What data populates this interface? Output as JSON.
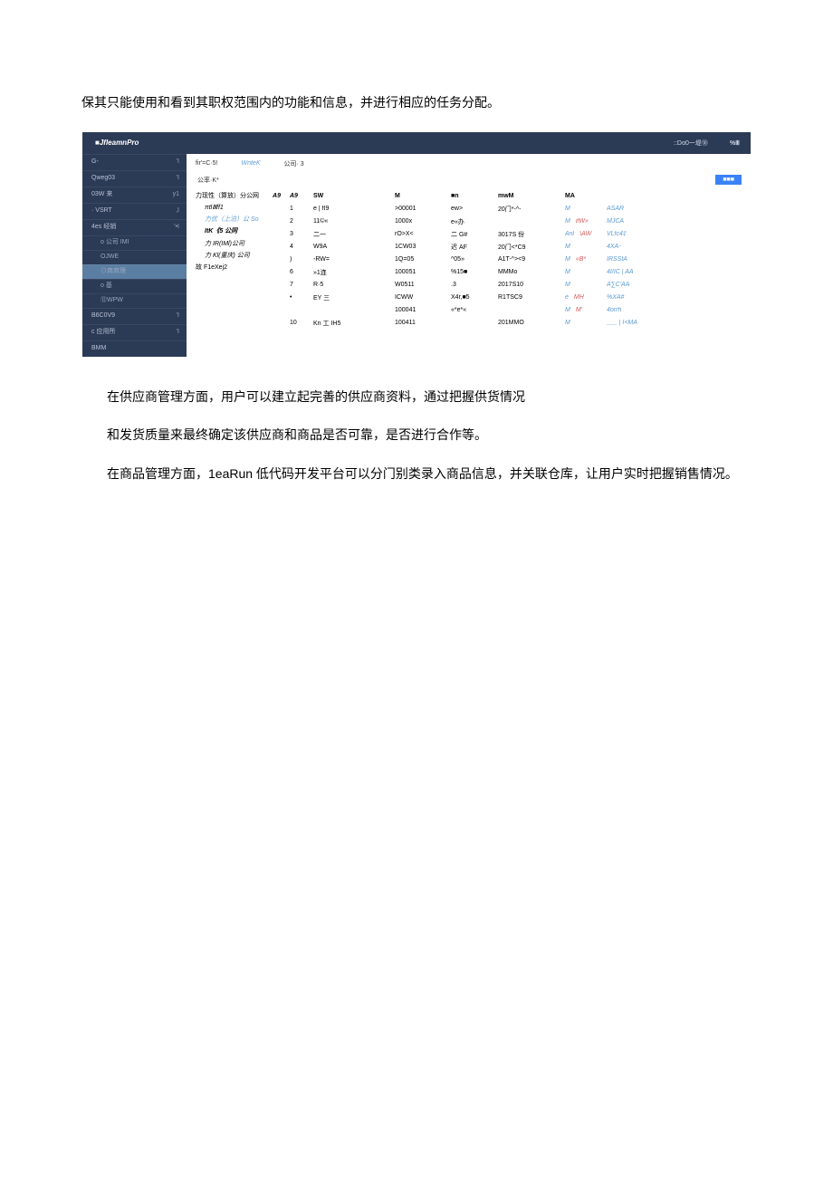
{
  "paragraphs": {
    "p1": "保其只能使用和看到其职权范围内的功能和信息，并进行相应的任务分配。",
    "p2": "在供应商管理方面，用户可以建立起完善的供应商资料，通过把握供货情况",
    "p3": "和发货质量来最终确定该供应商和商品是否可靠，是否进行合作等。",
    "p4": "在商品管理方面，1eaRun 低代码开发平台可以分门别类录入商品信息，并关联仓库，让用户实时把握销售情况。"
  },
  "app": {
    "brand": "■JfleamnPro",
    "header": {
      "r1": "::Dα0一堤⑩",
      "r2": "%Ⅲ"
    },
    "sidebar": [
      {
        "label": "G-",
        "arrow": "'I",
        "sub": false
      },
      {
        "label": "Qweg03",
        "arrow": "'I",
        "sub": false
      },
      {
        "label": "03W 来",
        "arrow": "y1",
        "sub": false
      },
      {
        "label": "· VSRT",
        "arrow": "‚I",
        "sub": false
      },
      {
        "label": "4es 经销",
        "arrow": "'•I",
        "sub": false
      },
      {
        "label": "o 公司 IMI",
        "arrow": "",
        "sub": true
      },
      {
        "label": "OJWE",
        "arrow": "",
        "sub": true
      },
      {
        "label": "⊙商商理",
        "arrow": "",
        "sub": true,
        "active": true
      },
      {
        "label": "o 基",
        "arrow": "",
        "sub": true
      },
      {
        "label": "⑫WPW",
        "arrow": "",
        "sub": true
      },
      {
        "label": "B6C0V9",
        "arrow": "'I",
        "sub": false
      },
      {
        "label": "c 应用所",
        "arrow": "'I",
        "sub": false
      },
      {
        "label": "BMM",
        "arrow": "",
        "sub": false
      }
    ],
    "tabs": {
      "t1": "fir'=C·5!",
      "t2": "WnteK",
      "t3": "公司· 3"
    },
    "subtabs": {
      "s1": "公率·K*",
      "btn": "■■■"
    },
    "tree": {
      "row0": {
        "a": "力现性（算放）分公网",
        "b": "A9"
      },
      "rows": [
        "πtlⅢff1",
        "力优（上泊）公 So",
        "ItK《5 公同",
        "力 IR(IMl)公司",
        "力 Kl(重庆) 公司"
      ],
      "footer": "故 F1eXej2"
    },
    "table": {
      "head": [
        "A9",
        "SW",
        "M",
        "■n",
        "mwM",
        "MA",
        ""
      ],
      "rows": [
        {
          "c": [
            "1",
            "e  |  fI9",
            ">00001",
            "ew>",
            "20门*-^-",
            "M",
            "ASAR"
          ],
          "op": "teal"
        },
        {
          "c": [
            "2",
            "11©«",
            "1000x",
            "e«办",
            "",
            "M  ifW»",
            "MJCA"
          ],
          "op": "mix"
        },
        {
          "c": [
            "3",
            "二一",
            "rO>X<",
            "二 G#",
            "3017S 份",
            "Anl  \\AW",
            "VLfc4‡"
          ],
          "op": "tteal"
        },
        {
          "c": [
            "4",
            "W9A",
            "1CW03",
            "迟 AF",
            "20门<*C9",
            "M",
            "4XA-"
          ],
          "op": "gray"
        },
        {
          "c": [
            ")",
            "-RW=",
            "1Q=05",
            "^05»",
            "A1T-^><9",
            "M  «B*",
            "IRSStA"
          ],
          "op": "teal2"
        },
        {
          "c": [
            "6",
            "»1连",
            "100051",
            "%15■",
            "MMMo",
            "M",
            "4I/IC  |  AA"
          ],
          "op": "split"
        },
        {
          "c": [
            "7",
            "    R·5",
            "W0511",
            ".3",
            "2017S10",
            "M",
            "A∑C'AA"
          ],
          "op": "teal"
        },
        {
          "c": [
            "•",
            "EY 三",
            "ICWW",
            "X4r,■5",
            "R1TSC9",
            "e  MH",
            "%XA#"
          ],
          "op": "mix2"
        },
        {
          "c": [
            "",
            "",
            "100041",
            "«*e*«",
            "",
            "M  M'",
            "4orrh"
          ],
          "op": "dual"
        },
        {
          "c": [
            "10",
            "Kn 工 IH5",
            "100411",
            "",
            "201MMO",
            "M",
            "___  |  I<MA"
          ],
          "op": "gsplit"
        }
      ]
    }
  }
}
